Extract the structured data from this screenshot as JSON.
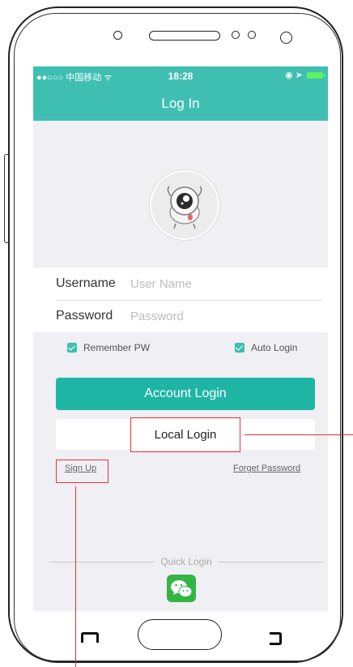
{
  "status_bar": {
    "carrier": "●●○○○ 中国移动 ᯤ",
    "time": "18:28",
    "icons": "◉ ➤"
  },
  "header": {
    "title": "Log In"
  },
  "form": {
    "username_label": "Username",
    "username_placeholder": "User Name",
    "password_label": "Password",
    "password_placeholder": "Password"
  },
  "options": {
    "remember_label": "Remember PW",
    "auto_label": "Auto Login"
  },
  "buttons": {
    "account_login": "Account Login",
    "local_login": "Local Login"
  },
  "links": {
    "sign_up": "Sign Up",
    "forget_password": "Forget Password"
  },
  "quick_login": {
    "label": "Quick Login"
  },
  "colors": {
    "accent": "#1fb5a4",
    "header": "#3ebfb1",
    "annotation": "#e33333",
    "wechat": "#33b546"
  }
}
